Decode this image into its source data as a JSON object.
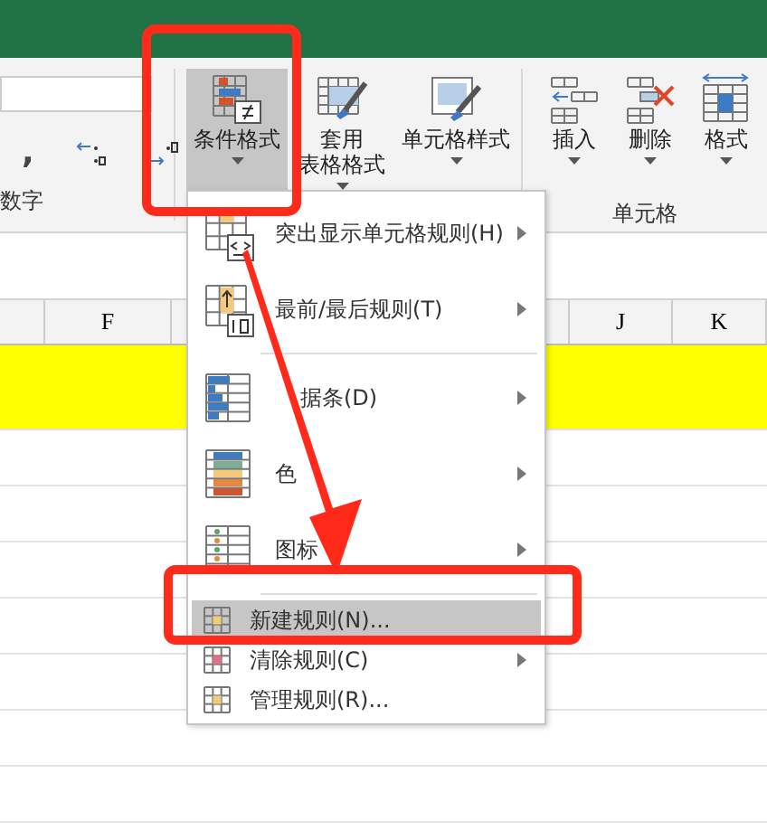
{
  "number_group": {
    "comma": ",",
    "label": "数字"
  },
  "style_buttons": [
    {
      "lines": [
        "条件格式"
      ],
      "selected": true,
      "kind": "conditional"
    },
    {
      "lines": [
        "套用",
        "表格格式"
      ],
      "selected": false,
      "kind": "table"
    },
    {
      "lines": [
        "单元格样式"
      ],
      "selected": false,
      "kind": "cellstyle"
    }
  ],
  "cell_buttons": [
    {
      "lines": [
        "插入"
      ],
      "kind": "insert"
    },
    {
      "lines": [
        "删除"
      ],
      "kind": "delete"
    },
    {
      "lines": [
        "格式"
      ],
      "kind": "format"
    }
  ],
  "cell_group_label": "单元格",
  "columns": [
    {
      "label": "F"
    },
    {
      "label": "J"
    },
    {
      "label": "K"
    }
  ],
  "menu": [
    {
      "label": "突出显示单元格规则(H)",
      "kind": "highlight",
      "submenu": true,
      "selected": false
    },
    {
      "label": "最前/最后规则(T)",
      "kind": "topbottom",
      "submenu": true,
      "selected": false
    },
    {
      "kind": "separator"
    },
    {
      "label": "据条(D)",
      "kind": "databar",
      "submenu": true,
      "selected": false
    },
    {
      "label": "色",
      "kind": "colorscale",
      "submenu": true,
      "selected": false
    },
    {
      "label": "图标",
      "kind": "iconset",
      "submenu": true,
      "selected": false
    },
    {
      "kind": "separator"
    },
    {
      "label": "新建规则(N)...",
      "kind": "new",
      "submenu": false,
      "selected": true
    },
    {
      "label": "清除规则(C)",
      "kind": "clear",
      "submenu": true,
      "selected": false
    },
    {
      "label": "管理规则(R)...",
      "kind": "manage",
      "submenu": false,
      "selected": false
    }
  ],
  "annotations": [
    {
      "kind": "box"
    },
    {
      "kind": "box"
    },
    {
      "kind": "arrow"
    }
  ]
}
